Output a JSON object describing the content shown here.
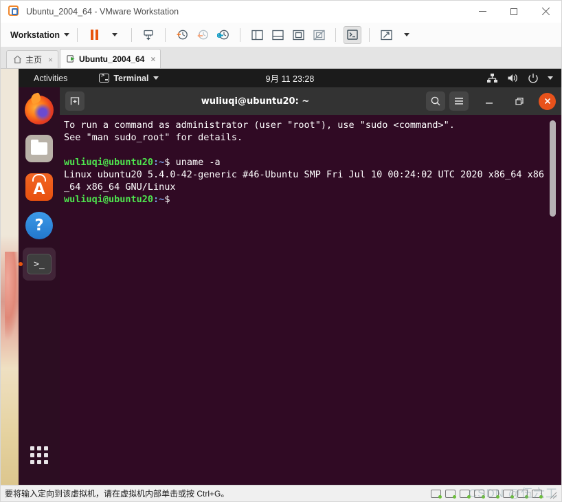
{
  "window": {
    "title": "Ubuntu_2004_64 - VMware Workstation",
    "app_icon": "vmware-logo-icon",
    "controls": {
      "minimize": "minimize-icon",
      "maximize": "maximize-icon",
      "close": "close-icon"
    }
  },
  "toolbar": {
    "menu_label": "Workstation",
    "buttons": [
      {
        "name": "pause-vm",
        "icon": "pause-icon"
      },
      {
        "name": "pause-dropdown",
        "icon": "chevron-down-icon"
      },
      {
        "name": "send-ctrl-alt-del",
        "icon": "send-key-icon"
      },
      {
        "name": "take-snapshot",
        "icon": "snapshot-add-icon"
      },
      {
        "name": "revert-snapshot",
        "icon": "snapshot-revert-icon"
      },
      {
        "name": "manage-snapshots",
        "icon": "snapshot-manage-icon"
      },
      {
        "name": "show-left-sidebar",
        "icon": "panel-left-icon"
      },
      {
        "name": "show-bottom-panel",
        "icon": "panel-bottom-icon"
      },
      {
        "name": "show-thumbnail-bar",
        "icon": "thumbnail-bar-icon"
      },
      {
        "name": "hide-thumbnail-bar",
        "icon": "thumbnail-bar-off-icon"
      },
      {
        "name": "console-view",
        "icon": "console-icon"
      },
      {
        "name": "fullscreen",
        "icon": "fullscreen-icon"
      },
      {
        "name": "fullscreen-dropdown",
        "icon": "chevron-down-icon"
      }
    ]
  },
  "tabs": [
    {
      "label": "主页",
      "icon": "home-icon",
      "active": false,
      "close": "×"
    },
    {
      "label": "Ubuntu_2004_64",
      "icon": "vm-running-icon",
      "active": true,
      "close": "×"
    }
  ],
  "guest": {
    "topbar": {
      "activities": "Activities",
      "app_menu": "Terminal",
      "app_menu_icon": "terminal-icon",
      "clock": "9月 11  23:28",
      "tray": [
        {
          "name": "network-icon",
          "glyph": "network"
        },
        {
          "name": "volume-icon",
          "glyph": "volume"
        },
        {
          "name": "power-icon",
          "glyph": "power"
        },
        {
          "name": "chevron-down-icon",
          "glyph": "caret"
        }
      ]
    },
    "dock": {
      "items": [
        {
          "name": "dock-item-firefox",
          "label": "Firefox",
          "icon": "firefox-icon",
          "running": false
        },
        {
          "name": "dock-item-files",
          "label": "Files",
          "icon": "files-icon",
          "running": false
        },
        {
          "name": "dock-item-ubuntu-software",
          "label": "Ubuntu Software",
          "icon": "software-icon",
          "running": false
        },
        {
          "name": "dock-item-help",
          "label": "Help",
          "icon": "help-icon",
          "running": false
        },
        {
          "name": "dock-item-terminal",
          "label": "Terminal",
          "icon": "terminal-icon",
          "running": true
        }
      ],
      "show_applications": "Show Applications"
    },
    "terminal": {
      "title": "wuliuqi@ubuntu20: ~",
      "new_tab_icon": "new-tab-icon",
      "search_icon": "search-icon",
      "menu_icon": "hamburger-menu-icon",
      "minimize_icon": "minimize-icon",
      "maximize_icon": "maximize-icon",
      "close_icon": "close-icon",
      "lines": [
        {
          "segments": [
            {
              "text": "To run a command as administrator (user \"root\"), use \"sudo <command>\".",
              "style": "white"
            }
          ]
        },
        {
          "segments": [
            {
              "text": "See \"man sudo_root\" for details.",
              "style": "white"
            }
          ]
        },
        {
          "segments": [
            {
              "text": "",
              "style": "white"
            }
          ]
        },
        {
          "segments": [
            {
              "text": "wuliuqi@ubuntu20",
              "style": "green"
            },
            {
              "text": ":~",
              "style": "blue"
            },
            {
              "text": "$ uname -a",
              "style": "white"
            }
          ]
        },
        {
          "segments": [
            {
              "text": "Linux ubuntu20 5.4.0-42-generic #46-Ubuntu SMP Fri Jul 10 00:24:02 UTC 2020 x86_64 x86_64 x86_64 GNU/Linux",
              "style": "white"
            }
          ]
        },
        {
          "segments": [
            {
              "text": "wuliuqi@ubuntu20",
              "style": "green"
            },
            {
              "text": ":~",
              "style": "blue"
            },
            {
              "text": "$ ",
              "style": "white"
            }
          ]
        }
      ]
    }
  },
  "statusbar": {
    "message": "要将输入定向到该虚拟机，请在虚拟机内部单击或按 Ctrl+G。",
    "devices": [
      {
        "name": "status-device-hard-disk",
        "icon": "hard-disk-icon"
      },
      {
        "name": "status-device-cdrom",
        "icon": "cdrom-icon"
      },
      {
        "name": "status-device-floppy",
        "icon": "floppy-icon"
      },
      {
        "name": "status-device-network",
        "icon": "network-icon"
      },
      {
        "name": "status-device-usb",
        "icon": "usb-icon"
      },
      {
        "name": "status-device-sound",
        "icon": "sound-icon"
      },
      {
        "name": "status-device-printer",
        "icon": "printer-icon"
      },
      {
        "name": "status-device-display",
        "icon": "display-icon"
      }
    ]
  },
  "watermark": "CSDN @伍六工",
  "colors": {
    "terminal_bg": "#300a24",
    "dock_bg": "#2c0d22",
    "topbar_bg": "#1b1b1b",
    "prompt_green": "#4ee44e",
    "prompt_blue": "#7b9fe8",
    "accent_orange": "#e8550d"
  }
}
